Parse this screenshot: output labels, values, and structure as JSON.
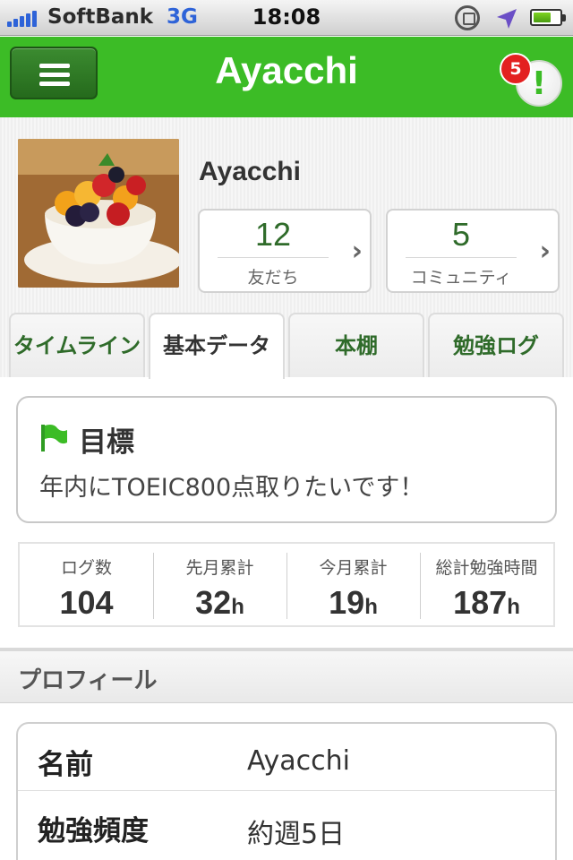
{
  "status_bar": {
    "carrier": "SoftBank",
    "network": "3G",
    "time": "18:08",
    "icons": [
      "signal-bars-icon",
      "rotation-lock-icon",
      "location-arrow-icon",
      "battery-icon"
    ],
    "battery_level": 0.6
  },
  "header": {
    "title": "Ayacchi",
    "menu_icon": "hamburger-icon",
    "notification_icon": "exclamation-icon",
    "notification_count": "5",
    "color": "#3cbc26"
  },
  "profile": {
    "name": "Ayacchi",
    "avatar": "fruit-parfait-photo",
    "friends": {
      "count": "12",
      "label": "友だち"
    },
    "communities": {
      "count": "5",
      "label": "コミュニティ"
    }
  },
  "tabs": [
    {
      "label": "タイムライン",
      "active": false
    },
    {
      "label": "基本データ",
      "active": true
    },
    {
      "label": "本棚",
      "active": false
    },
    {
      "label": "勉強ログ",
      "active": false
    }
  ],
  "goal": {
    "icon": "green-flag-icon",
    "title": "目標",
    "text": "年内にTOEIC800点取りたいです！"
  },
  "stats": [
    {
      "label": "ログ数",
      "value": "104",
      "unit": ""
    },
    {
      "label": "先月累計",
      "value": "32",
      "unit": "h"
    },
    {
      "label": "今月累計",
      "value": "19",
      "unit": "h"
    },
    {
      "label": "総計勉強時間",
      "value": "187",
      "unit": "h"
    }
  ],
  "profile_section": {
    "title": "プロフィール",
    "rows": [
      {
        "key": "名前",
        "value": "Ayacchi"
      },
      {
        "key": "勉強頻度",
        "value": "約週5日"
      }
    ]
  }
}
